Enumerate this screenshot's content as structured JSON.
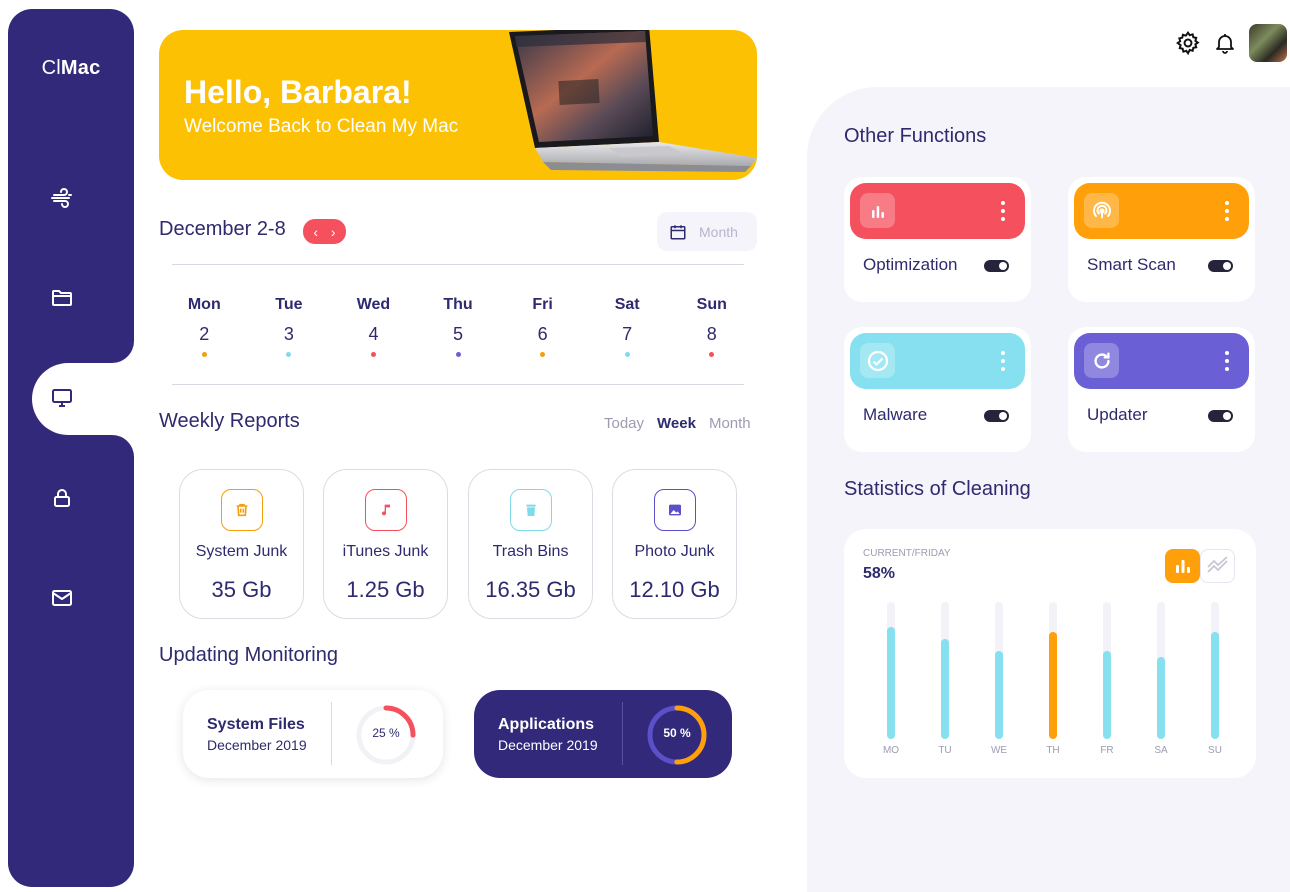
{
  "app": {
    "logo_light": "Cl",
    "logo_bold": "Mac"
  },
  "sidebar": {
    "items": [
      {
        "icon": "wind-icon",
        "active": false
      },
      {
        "icon": "folder-icon",
        "active": false
      },
      {
        "icon": "monitor-icon",
        "active": true
      },
      {
        "icon": "lock-icon",
        "active": false
      },
      {
        "icon": "mail-icon",
        "active": false
      }
    ]
  },
  "hero": {
    "greeting": "Hello, Barbara!",
    "subtitle": "Welcome Back to Clean My Mac"
  },
  "calendar": {
    "range": "December 2-8",
    "month_placeholder": "Month",
    "days": [
      {
        "name": "Mon",
        "date": "2",
        "dot": "#f59e0b"
      },
      {
        "name": "Tue",
        "date": "3",
        "dot": "#7fdbe9"
      },
      {
        "name": "Wed",
        "date": "4",
        "dot": "#f4505e"
      },
      {
        "name": "Thu",
        "date": "5",
        "dot": "#6b5fd6"
      },
      {
        "name": "Fri",
        "date": "6",
        "dot": "#f59e0b"
      },
      {
        "name": "Sat",
        "date": "7",
        "dot": "#7fdbe9"
      },
      {
        "name": "Sun",
        "date": "8",
        "dot": "#f4505e"
      }
    ]
  },
  "weekly": {
    "title": "Weekly Reports",
    "filters": [
      "Today",
      "Week",
      "Month"
    ],
    "active_filter": "Week",
    "cards": [
      {
        "label": "System Junk",
        "value": "35 Gb",
        "icon": "trash-icon",
        "color": "#f59e0b"
      },
      {
        "label": "iTunes Junk",
        "value": "1.25 Gb",
        "icon": "music-note-icon",
        "color": "#f4505e"
      },
      {
        "label": "Trash Bins",
        "value": "16.35 Gb",
        "icon": "bin-icon",
        "color": "#7fdbe9"
      },
      {
        "label": "Photo Junk",
        "value": "12.10 Gb",
        "icon": "image-icon",
        "color": "#5b50c8"
      }
    ]
  },
  "monitoring": {
    "title": "Updating Monitoring",
    "items": [
      {
        "title": "System Files",
        "subtitle": "December 2019",
        "percent_label": "25 %",
        "progress": 0.25
      },
      {
        "title": "Applications",
        "subtitle": "December 2019",
        "percent_label": "50 %",
        "progress": 0.5
      }
    ]
  },
  "functions": {
    "title": "Other Functions",
    "items": [
      {
        "name": "Optimization",
        "color": "#f4505e",
        "icon": "bar-chart-icon",
        "enabled": true
      },
      {
        "name": "Smart Scan",
        "color": "#ff9f0a",
        "icon": "wifi-scan-icon",
        "enabled": true
      },
      {
        "name": "Malware",
        "color": "#86e0ef",
        "icon": "check-circle-icon",
        "enabled": true
      },
      {
        "name": "Updater",
        "color": "#6b5fd6",
        "icon": "refresh-icon",
        "enabled": true
      }
    ]
  },
  "statistics": {
    "title": "Statistics of Cleaning",
    "caption": "CURRENT/FRIDAY",
    "value": "58%",
    "chart_data": {
      "type": "bar",
      "categories": [
        "MO",
        "TU",
        "WE",
        "TH",
        "FR",
        "SA",
        "SU"
      ],
      "values": [
        82,
        73,
        64,
        78,
        64,
        60,
        78
      ],
      "ylim": [
        0,
        100
      ],
      "highlight": "TH",
      "colors": {
        "default": "#86e0ef",
        "highlight": "#ff9f0a"
      }
    }
  }
}
